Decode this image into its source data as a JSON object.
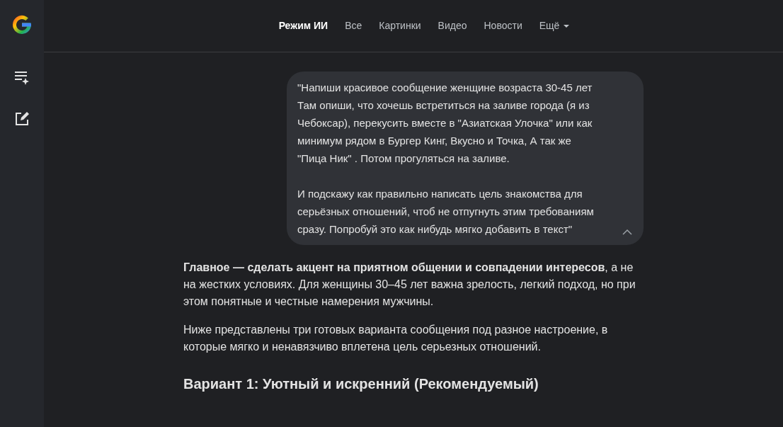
{
  "tabs": [
    {
      "label": "Режим ИИ",
      "selected": true,
      "kind": "tab"
    },
    {
      "label": "Все",
      "selected": false,
      "kind": "tab"
    },
    {
      "label": "Картинки",
      "selected": false,
      "kind": "tab"
    },
    {
      "label": "Видео",
      "selected": false,
      "kind": "tab"
    },
    {
      "label": "Новости",
      "selected": false,
      "kind": "tab"
    },
    {
      "label": "Ещё",
      "selected": false,
      "kind": "menu"
    }
  ],
  "user_message": {
    "text": "\"Напиши красивое сообщение женщине возраста 30-45 лет\nТам опиши, что хочешь встретиться на заливе города (я из Чебоксар), перекусить вместе в \"Азиатская Улочка\" или как минимум рядом в Бургер Кинг, Вкусно и Точка, А так же \"Пица Ник\" . Потом прогуляться на заливе.\n\nИ подскажу как правильно написать цель знакомства для серьёзных отношений, чтоб не отпугнуть этим требованиям сразу. Попробуй это как нибудь мягко добавить в текст\"",
    "expanded": true
  },
  "answer": [
    {
      "kind": "paragraph",
      "text": "**Главное — сделать акцент на приятном общении и совпадении интересов**, а не на жестких условиях. Для женщины 30–45 лет важна зрелость, легкий подход, но при этом понятные и честные намерения мужчины."
    },
    {
      "kind": "paragraph",
      "text": "Ниже представлены три готовых варианта сообщения под разное настроение, в которые мягко и ненавязчиво вплетена цель серьезных отношений."
    },
    {
      "kind": "heading",
      "text": "Вариант 1: Уютный и искренний (Рекомендуемый)"
    }
  ]
}
